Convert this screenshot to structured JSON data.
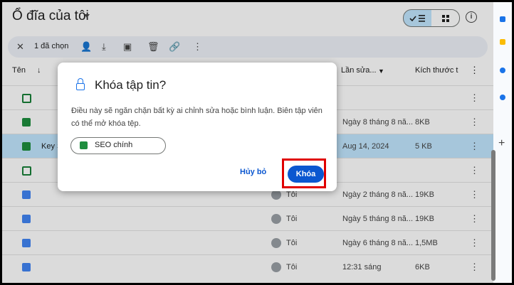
{
  "header": {
    "title": "Ổ đĩa của tôi",
    "list_view_icon": "check-list-icon",
    "grid_view_icon": "grid-icon",
    "info_icon": "info-icon"
  },
  "selection": {
    "count_label": "1 đã chọn",
    "actions": [
      "close-icon",
      "share-icon",
      "download-icon",
      "move-icon",
      "trash-icon",
      "link-icon",
      "more-icon"
    ]
  },
  "columns": {
    "name": "Tên",
    "modified": "Lần sửa...",
    "size": "Kích thước t"
  },
  "rows": [
    {
      "icon": "form",
      "name": "",
      "owner": "",
      "date": "",
      "size": "",
      "selected": false
    },
    {
      "icon": "sheet",
      "name": "",
      "owner": "",
      "date": "Ngày 8 tháng 8 nă...",
      "size": "8KB",
      "selected": false
    },
    {
      "icon": "sheet",
      "name": "Key S",
      "owner": "",
      "date": "Aug 14, 2024",
      "size": "5 KB",
      "selected": true
    },
    {
      "icon": "form",
      "name": "",
      "owner": "",
      "date": "",
      "size": "",
      "selected": false
    },
    {
      "icon": "doc",
      "name": "",
      "owner": "Tôi",
      "date": "Ngày 2 tháng 8 nă...",
      "size": "19KB",
      "selected": false
    },
    {
      "icon": "doc",
      "name": "",
      "owner": "Tôi",
      "date": "Ngày 5 tháng 8 nă...",
      "size": "19KB",
      "selected": false
    },
    {
      "icon": "doc",
      "name": "",
      "owner": "Tôi",
      "date": "Ngày 6 tháng 8 nă...",
      "size": "1,5MB",
      "selected": false
    },
    {
      "icon": "doc",
      "name": "",
      "owner": "Tôi",
      "date": "12:31 sáng",
      "size": "6KB",
      "selected": false
    }
  ],
  "dialog": {
    "title": "Khóa tập tin?",
    "body": "Điều này sẽ ngăn chặn bất kỳ ai chỉnh sửa hoặc bình luận. Biên tập viên có thể mở khóa tệp.",
    "chip_label": "SEO chính",
    "cancel_label": "Hủy bỏ",
    "confirm_label": "Khóa"
  },
  "colors": {
    "accent": "#0b57d0",
    "selected_row": "#c2e7ff",
    "highlight": "#e00000",
    "sheet": "#1e8e3e",
    "doc": "#4285f4"
  }
}
